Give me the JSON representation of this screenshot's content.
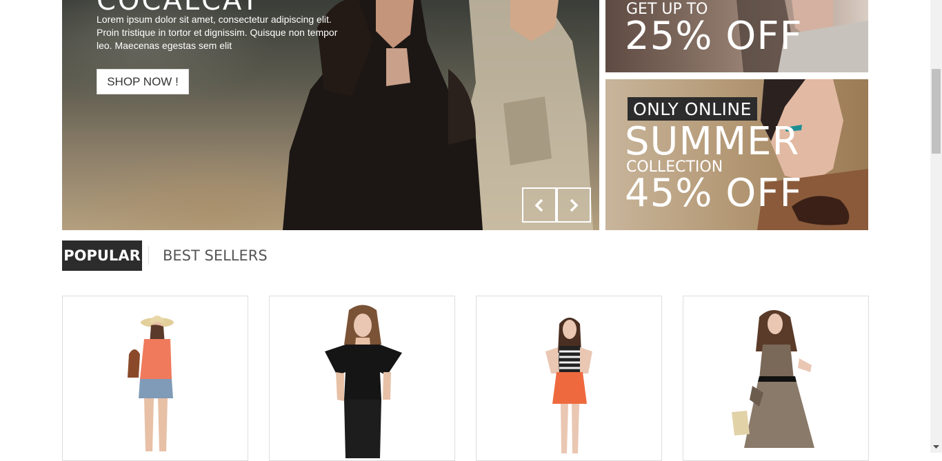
{
  "slider": {
    "title_fragment": "COCALCAT",
    "text": "Lorem ipsum dolor sit amet, consectetur adipiscing elit. Proin tristique in tortor et dignissim. Quisque non tempor leo. Maecenas egestas sem elit",
    "button_label": "SHOP NOW !",
    "prev_icon": "chevron-left-icon",
    "next_icon": "chevron-right-icon"
  },
  "banners": [
    {
      "line1": "GET UP TO",
      "line2": "25% OFF"
    },
    {
      "badge": "ONLY ONLINE",
      "line1": "SUMMER",
      "line2": "COLLECTION",
      "line3": "45% OFF"
    }
  ],
  "tabs": [
    {
      "label": "POPULAR",
      "active": true
    },
    {
      "label": "BEST SELLERS",
      "active": false
    }
  ],
  "products": [
    {
      "name": "product-hat-orange-top-denim-shorts"
    },
    {
      "name": "product-black-ruffle-top"
    },
    {
      "name": "product-striped-top-orange-skirt"
    },
    {
      "name": "product-leopard-print-dress"
    }
  ],
  "colors": {
    "dark": "#2c2c2c",
    "tab_inactive": "#555555",
    "border": "#dddddd"
  }
}
